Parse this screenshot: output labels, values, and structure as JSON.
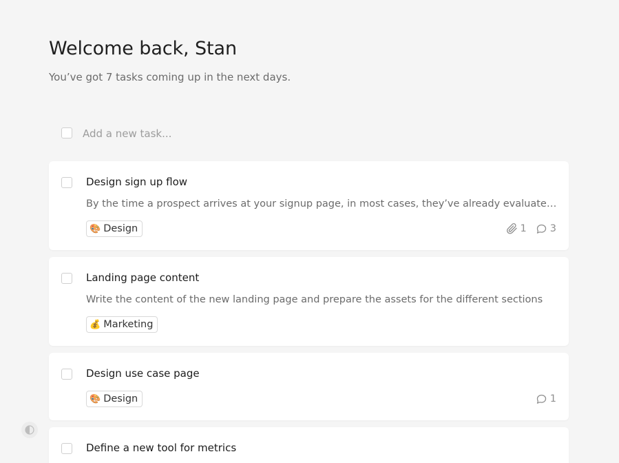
{
  "header": {
    "title": "Welcome back, Stan",
    "subtitle": "You’ve got 7 tasks coming up in the next days."
  },
  "new_task": {
    "placeholder": "Add a new task..."
  },
  "tasks": [
    {
      "title": "Design sign up flow",
      "description": "By the time a prospect arrives at your signup page, in most cases, they’ve already evaluated your product",
      "tag": {
        "label": "Design",
        "emoji": "🎨"
      },
      "attachments": "1",
      "comments": "3"
    },
    {
      "title": "Landing page content",
      "description": "Write the content of the new landing page and prepare the assets for the different sections",
      "tag": {
        "label": "Marketing",
        "emoji": "💰"
      }
    },
    {
      "title": "Design use case page",
      "tag": {
        "label": "Design",
        "emoji": "🎨"
      },
      "comments": "1"
    },
    {
      "title": "Define a new tool for metrics"
    }
  ],
  "colors": {
    "background": "#f5f5f5",
    "card": "#ffffff",
    "text_primary": "#1f1f1f",
    "text_secondary": "#6b6b6b",
    "muted": "#8f8f8f"
  },
  "icons": {
    "attachment": "paperclip-icon",
    "comment": "speech-bubble-icon",
    "theme": "half-circle-theme-icon"
  }
}
